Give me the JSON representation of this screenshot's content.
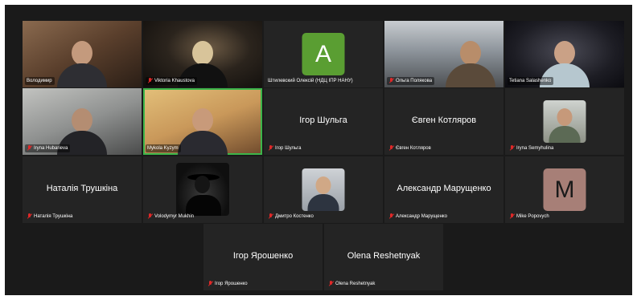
{
  "colors": {
    "stage_background": "#1a1a1a",
    "tile_background": "#242424",
    "active_speaker": "#3cb54a",
    "muted_mic": "#e02828",
    "avatar_green": "#5a9e32",
    "avatar_rose": "#a77f77"
  },
  "participants": [
    {
      "name": "Володимир",
      "muted": false,
      "kind": "video"
    },
    {
      "name": "Viktoria Khaustova",
      "muted": true,
      "kind": "video"
    },
    {
      "name": "Штилевский Олексій (НДЦ ІПР НАНУ)",
      "muted": false,
      "kind": "avatar",
      "letter": "A"
    },
    {
      "name": "Ольга Полякова",
      "muted": true,
      "kind": "video"
    },
    {
      "name": "Tetiana Salashenko",
      "muted": false,
      "kind": "video"
    },
    {
      "name": "Iryna Hubarieva",
      "muted": true,
      "kind": "video"
    },
    {
      "name": "Mykola Kyzym",
      "muted": false,
      "kind": "video",
      "active": true
    },
    {
      "name": "Ігор Шульга",
      "display": "Ігор Шульга",
      "muted": true,
      "kind": "name"
    },
    {
      "name": "Євген Котляров",
      "display": "Євген Котляров",
      "muted": true,
      "kind": "name"
    },
    {
      "name": "Iryna Semyhulina",
      "muted": true,
      "kind": "photo"
    },
    {
      "name": "Наталія Трушкіна",
      "display": "Наталія Трушкіна",
      "muted": true,
      "kind": "name"
    },
    {
      "name": "Volodymyr Mukhin",
      "muted": true,
      "kind": "photo"
    },
    {
      "name": "Дмитро Костенко",
      "muted": true,
      "kind": "photo"
    },
    {
      "name": "Александр Марущенко",
      "display": "Александр Марущенко",
      "muted": true,
      "kind": "name"
    },
    {
      "name": "Mike Popovych",
      "muted": true,
      "kind": "avatar",
      "letter": "M"
    },
    {
      "name": "Ігор Ярошенко",
      "display": "Ігор Ярошенко",
      "muted": true,
      "kind": "name"
    },
    {
      "name": "Olena Reshetnyak",
      "display": "Olena Reshetnyak",
      "muted": true,
      "kind": "name"
    }
  ]
}
